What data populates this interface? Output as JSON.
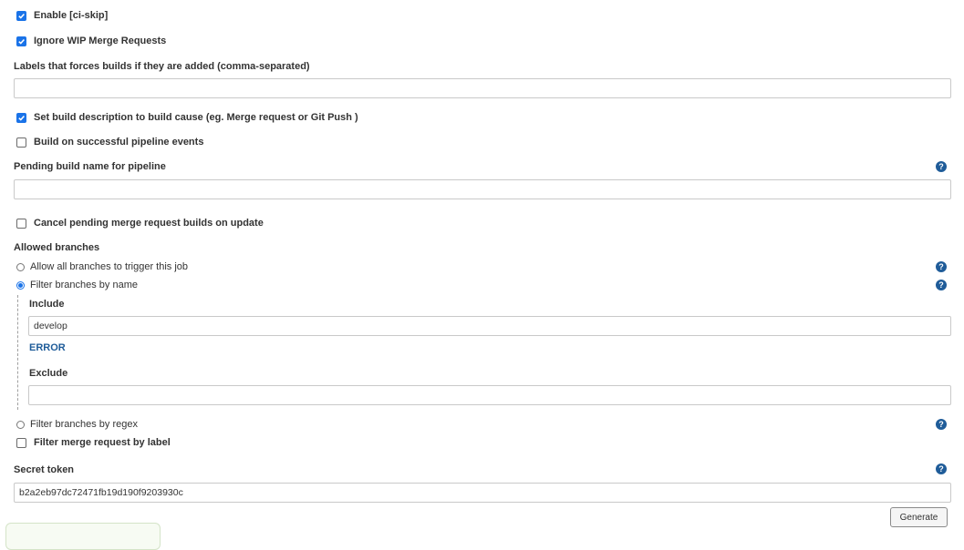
{
  "options": {
    "enable_ci_skip": {
      "label": "Enable [ci-skip]",
      "checked": true
    },
    "ignore_wip": {
      "label": "Ignore WIP Merge Requests",
      "checked": true
    },
    "set_build_description": {
      "label": "Set build description to build cause (eg. Merge request or Git Push )",
      "checked": true
    },
    "build_on_pipeline": {
      "label": "Build on successful pipeline events",
      "checked": false
    },
    "cancel_pending": {
      "label": "Cancel pending merge request builds on update",
      "checked": false
    },
    "filter_by_label": {
      "label": "Filter merge request by label",
      "checked": false
    }
  },
  "labels_force": {
    "label": "Labels that forces builds if they are added (comma-separated)",
    "value": ""
  },
  "pending_build": {
    "label": "Pending build name for pipeline",
    "value": ""
  },
  "allowed_branches": {
    "label": "Allowed branches",
    "allow_all": "Allow all branches to trigger this job",
    "filter_by_name": "Filter branches by name",
    "filter_by_regex": "Filter branches by regex",
    "selected": "filter_by_name"
  },
  "filter_name": {
    "include_label": "Include",
    "include_value": "develop",
    "error_text": "ERROR",
    "exclude_label": "Exclude",
    "exclude_value": ""
  },
  "secret_token": {
    "label": "Secret token",
    "value": "b2a2eb97dc72471fb19d190f9203930c",
    "generate_label": "Generate"
  },
  "icons": {
    "help": "question-circle-icon",
    "check": "checkmark-icon"
  },
  "help_glyph": "?",
  "colors": {
    "accent": "#1a73e8",
    "help": "#1f5c99",
    "error": "#1f5c99"
  }
}
